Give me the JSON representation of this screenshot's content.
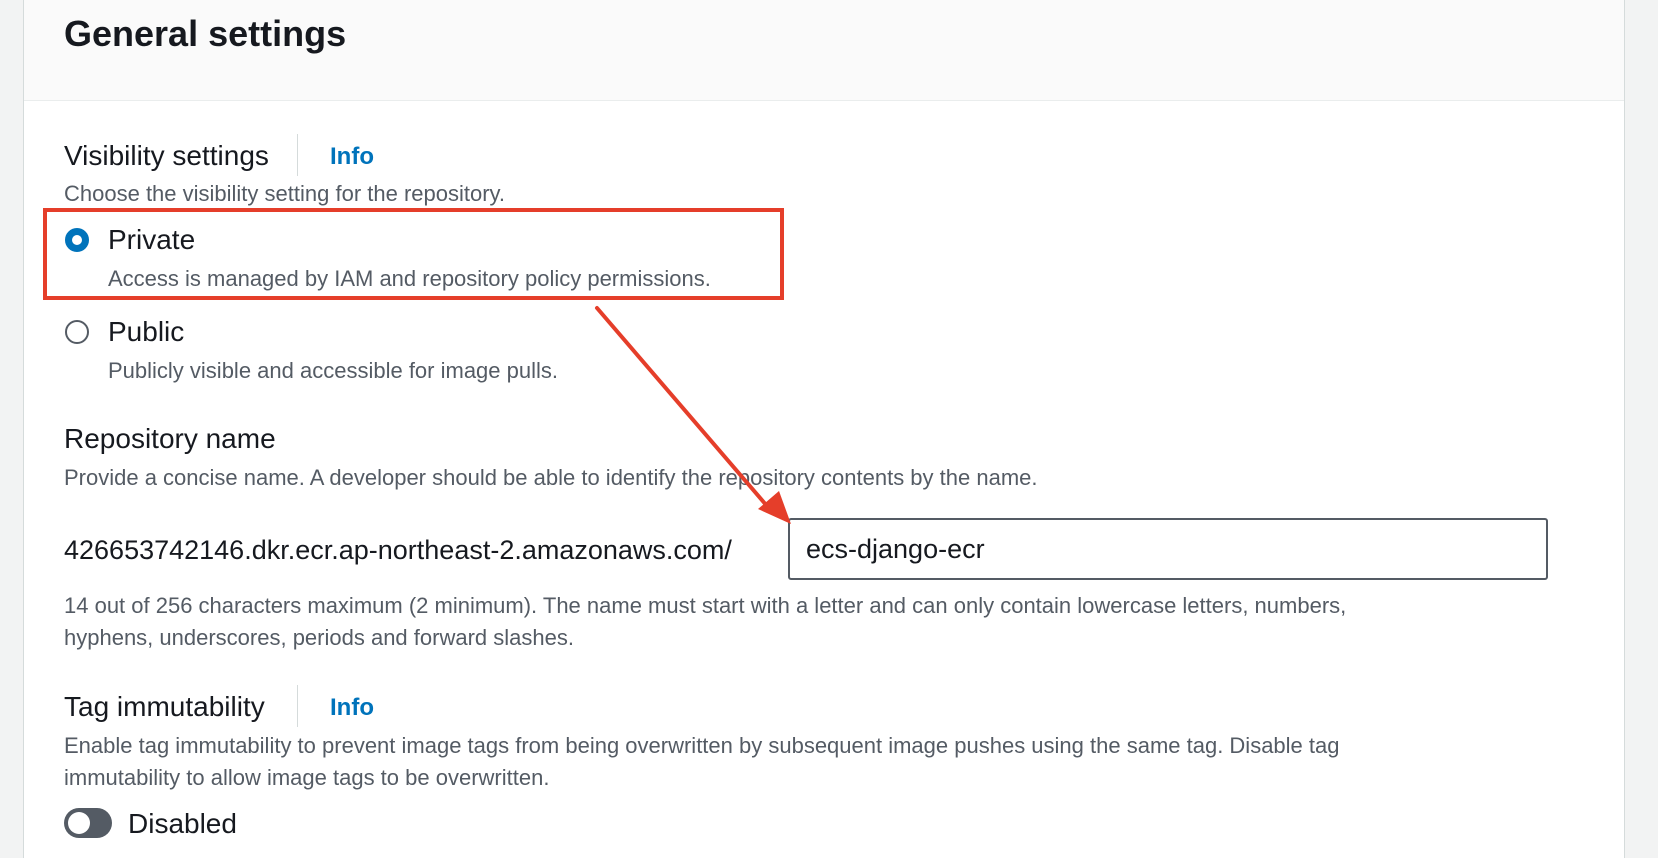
{
  "section": {
    "title": "General settings"
  },
  "visibility": {
    "label": "Visibility settings",
    "info": "Info",
    "description": "Choose the visibility setting for the repository.",
    "options": [
      {
        "label": "Private",
        "description": "Access is managed by IAM and repository policy permissions.",
        "selected": true
      },
      {
        "label": "Public",
        "description": "Publicly visible and accessible for image pulls.",
        "selected": false
      }
    ]
  },
  "repository": {
    "label": "Repository name",
    "description": "Provide a concise name. A developer should be able to identify the repository contents by the name.",
    "prefix": "426653742146.dkr.ecr.ap-northeast-2.amazonaws.com/",
    "value": "ecs-django-ecr",
    "constraint_line1": "14 out of 256 characters maximum (2 minimum). The name must start with a letter and can only contain lowercase letters, numbers,",
    "constraint_line2": "hyphens, underscores, periods and forward slashes."
  },
  "tag_immutability": {
    "label": "Tag immutability",
    "info": "Info",
    "description_line1": "Enable tag immutability to prevent image tags from being overwritten by subsequent image pushes using the same tag. Disable tag",
    "description_line2": "immutability to allow image tags to be overwritten.",
    "toggle_label": "Disabled",
    "enabled": false
  },
  "colors": {
    "accent": "#0073bb",
    "annotation": "#e53e2a",
    "text": "#16191f",
    "secondary_text": "#545b64"
  }
}
